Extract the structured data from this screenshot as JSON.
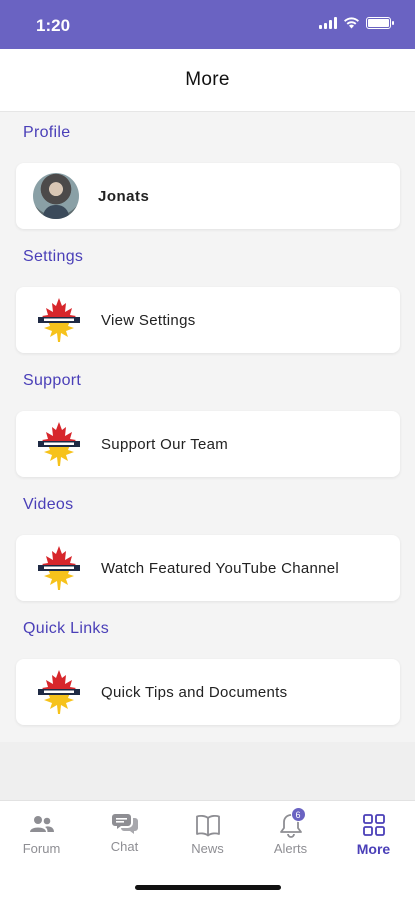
{
  "status_bar": {
    "time": "1:20"
  },
  "header": {
    "title": "More"
  },
  "sections": [
    {
      "title": "Profile",
      "item": {
        "label": "Jonats",
        "icon": "avatar"
      }
    },
    {
      "title": "Settings",
      "item": {
        "label": "View Settings",
        "icon": "maple-leaf-logo"
      }
    },
    {
      "title": "Support",
      "item": {
        "label": "Support Our Team",
        "icon": "maple-leaf-logo"
      }
    },
    {
      "title": "Videos",
      "item": {
        "label": "Watch Featured YouTube Channel",
        "icon": "maple-leaf-logo"
      }
    },
    {
      "title": "Quick Links",
      "item": {
        "label": "Quick Tips and Documents",
        "icon": "maple-leaf-logo"
      }
    }
  ],
  "tabs": [
    {
      "label": "Forum",
      "icon": "people-icon"
    },
    {
      "label": "Chat",
      "icon": "chat-icon"
    },
    {
      "label": "News",
      "icon": "book-icon"
    },
    {
      "label": "Alerts",
      "icon": "bell-icon",
      "badge": "6"
    },
    {
      "label": "More",
      "icon": "grid-icon",
      "active": true
    }
  ],
  "colors": {
    "accent": "#4a3fb8",
    "status_bar": "#6a63c2",
    "inactive": "#8e8e93"
  }
}
